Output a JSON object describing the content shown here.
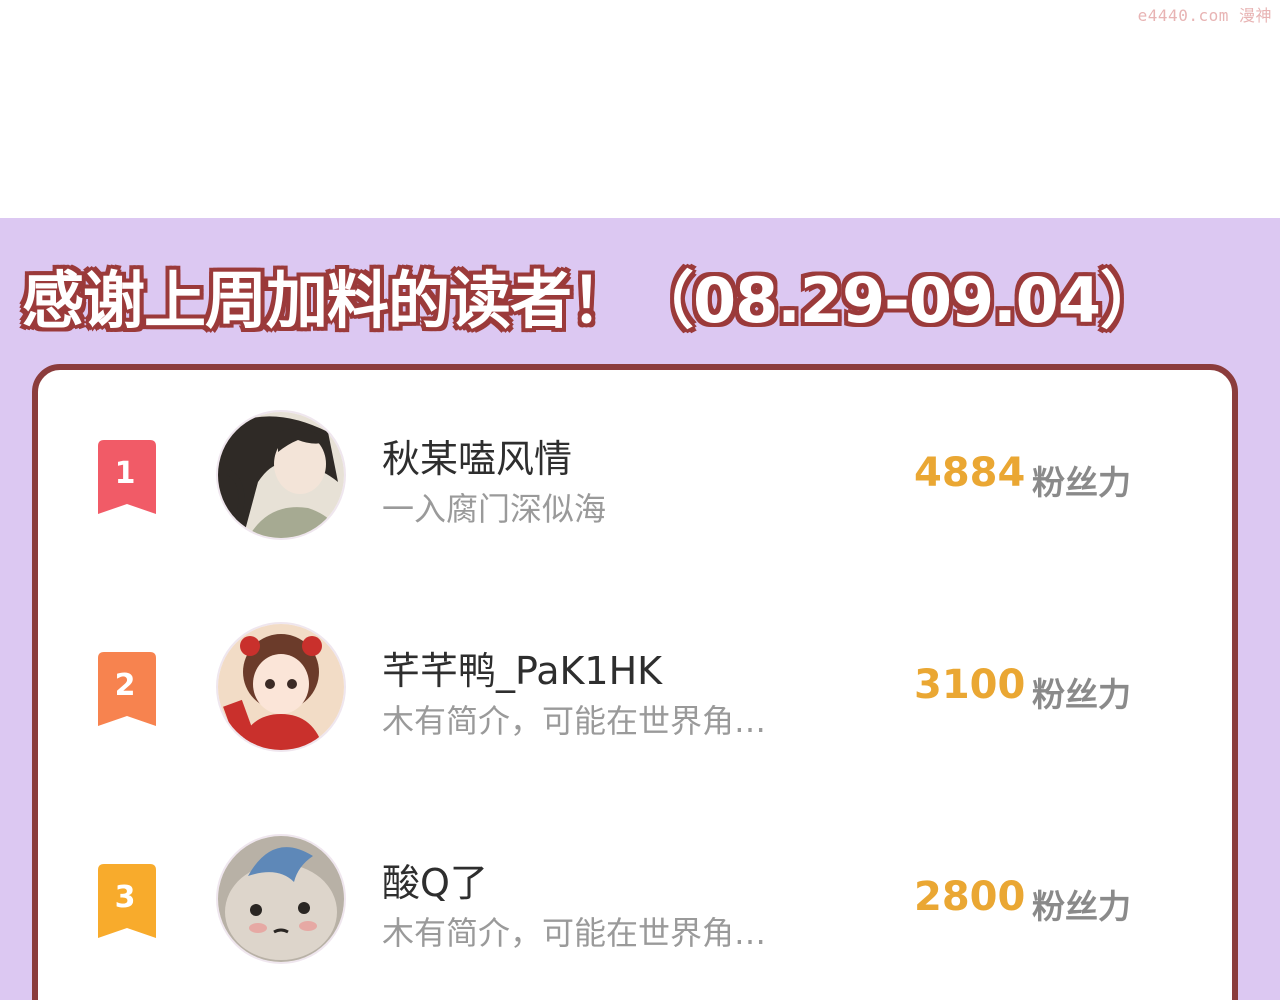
{
  "watermark": "e4440.com 漫神",
  "title": "感谢上周加料的读者！（08.29-09.04）",
  "colors": {
    "panel_bg": "#dcc8f2",
    "card_border": "#8b3c3c",
    "score": "#eaa733",
    "rank_1": "#f15b67",
    "rank_2": "#f7834f",
    "rank_3": "#f8ab2c"
  },
  "readers": [
    {
      "rank": "1",
      "name": "秋某嗑风情",
      "bio": "一入腐门深似海",
      "score": "4884",
      "unit": "粉丝力"
    },
    {
      "rank": "2",
      "name": "芊芊鸭_PaK1HK",
      "bio": "木有简介，可能在世界角…",
      "score": "3100",
      "unit": "粉丝力"
    },
    {
      "rank": "3",
      "name": "酸Q了",
      "bio": "木有简介，可能在世界角…",
      "score": "2800",
      "unit": "粉丝力"
    }
  ]
}
